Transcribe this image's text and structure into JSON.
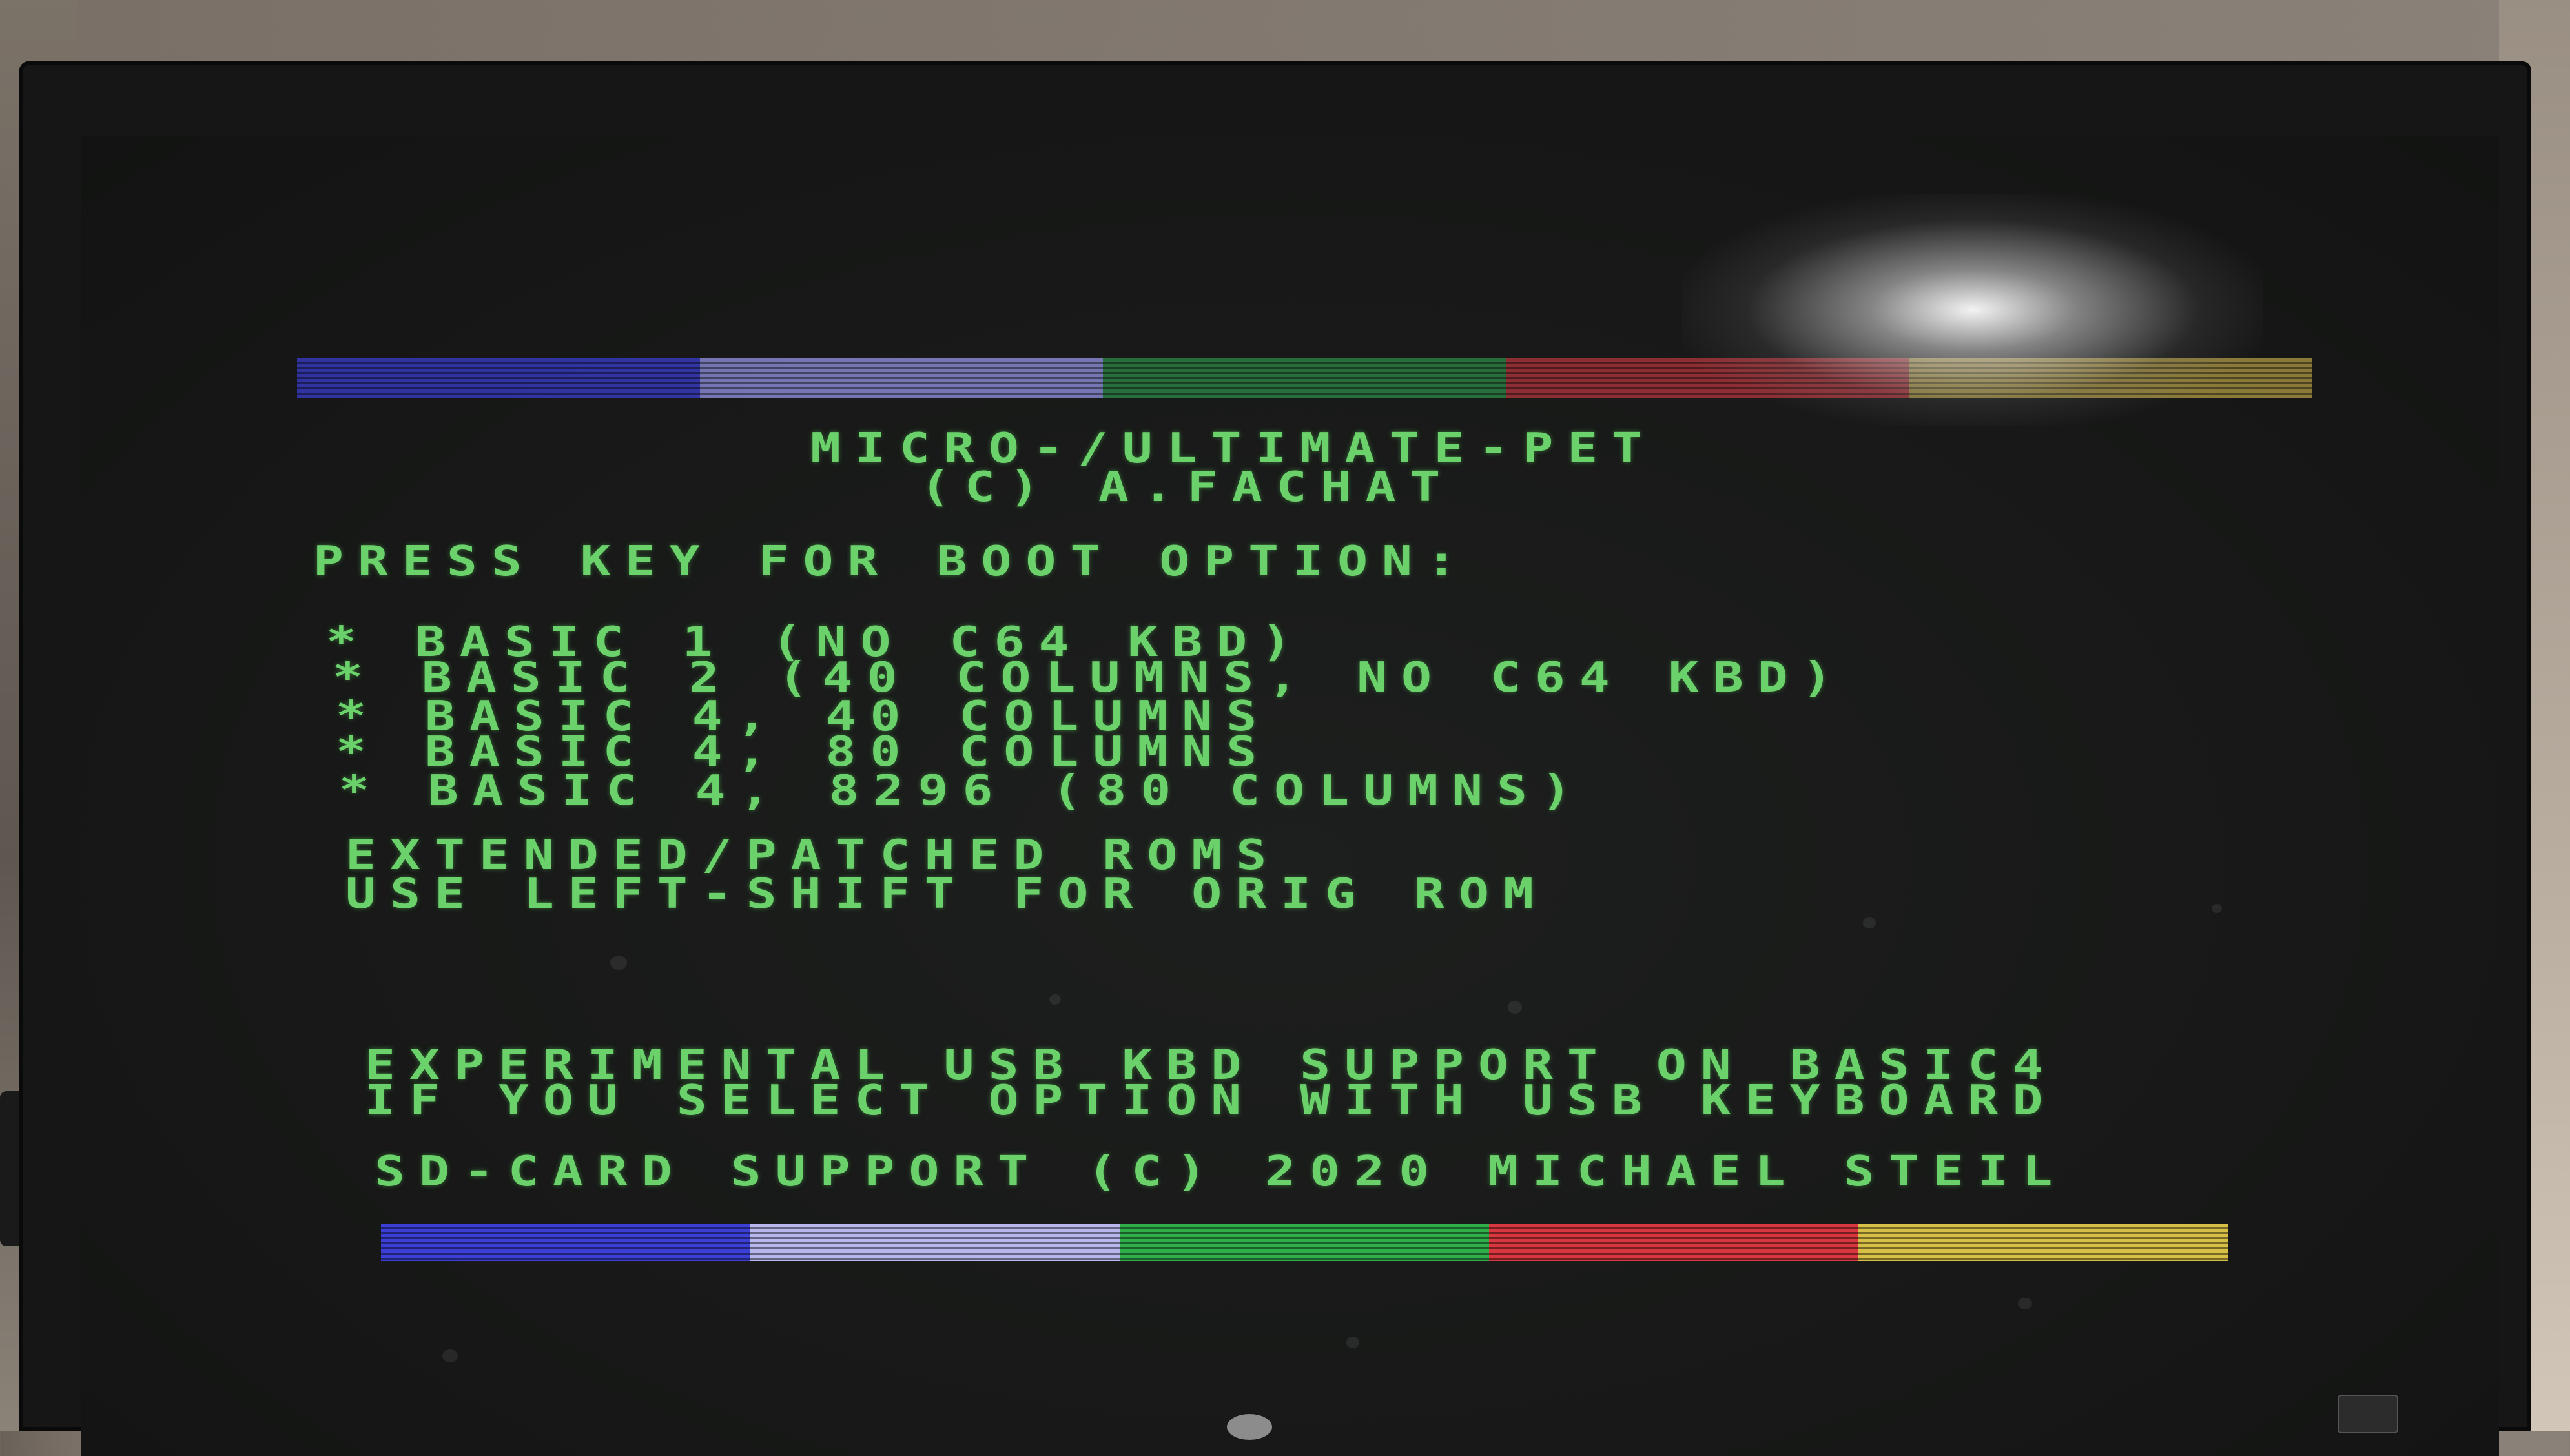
{
  "screen": {
    "title_line1": "MICRO-/ULTIMATE-PET",
    "title_line2": "(C) A.FACHAT",
    "prompt": "PRESS KEY FOR BOOT OPTION:",
    "options": [
      "* BASIC 1 (NO C64 KBD)",
      "* BASIC 2 (40 COLUMNS, NO C64 KBD)",
      "* BASIC 4, 40 COLUMNS",
      "* BASIC 4, 80 COLUMNS",
      "* BASIC 4, 8296 (80 COLUMNS)"
    ],
    "note_line1": "EXTENDED/PATCHED ROMS",
    "note_line2": "USE LEFT-SHIFT FOR ORIG ROM",
    "usb_line1": "EXPERIMENTAL USB KBD SUPPORT ON BASIC4",
    "usb_line2": "IF YOU SELECT OPTION WITH USB KEYBOARD",
    "sd_line": "SD-CARD SUPPORT (C) 2020 MICHAEL STEIL"
  },
  "colors": {
    "text_green": "#6bd26b",
    "bar": [
      "#3b3fd6",
      "#b7b7ee",
      "#2fae4a",
      "#d9373f",
      "#d8c046"
    ]
  }
}
